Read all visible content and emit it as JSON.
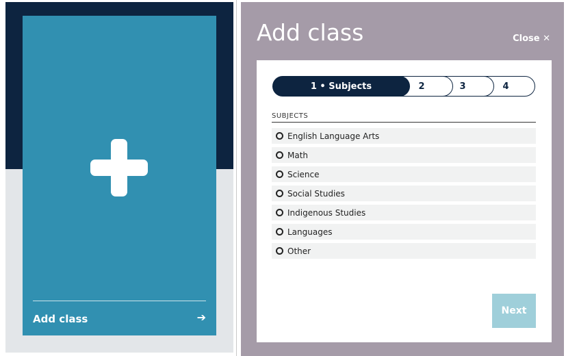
{
  "card": {
    "label": "Add class",
    "plus_icon": "plus-icon",
    "arrow_icon": "arrow-right-icon",
    "arrow_glyph": "➔"
  },
  "modal": {
    "title": "Add class",
    "close_label": "Close ✕",
    "stepper": {
      "steps": [
        {
          "label": "1 • Subjects",
          "active": true
        },
        {
          "label": "2",
          "active": false
        },
        {
          "label": "3",
          "active": false
        },
        {
          "label": "4",
          "active": false
        }
      ]
    },
    "subjects_heading": "SUBJECTS",
    "subjects": [
      "English Language Arts",
      "Math",
      "Science",
      "Social Studies",
      "Indigenous Studies",
      "Languages",
      "Other"
    ],
    "next_label": "Next"
  },
  "colors": {
    "navy": "#0d2440",
    "card_blue": "#3190b1",
    "overlay": "#a59ba8",
    "next_disabled": "#9fcfda",
    "row_bg": "#f1f2f2"
  }
}
